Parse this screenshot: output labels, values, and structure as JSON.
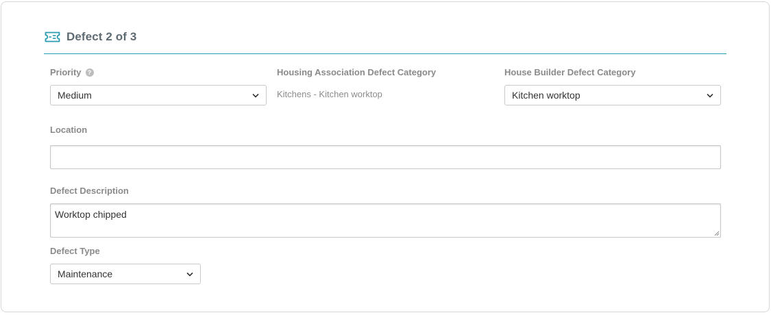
{
  "header": {
    "title": "Defect 2 of 3",
    "icon": "ticket-icon",
    "accent_color": "#2a9bb0"
  },
  "priority": {
    "label": "Priority",
    "help_icon": "?",
    "selected": "Medium"
  },
  "ha_category": {
    "label": "Housing Association Defect Category",
    "value": "Kitchens - Kitchen worktop"
  },
  "hb_category": {
    "label": "House Builder Defect Category",
    "selected": "Kitchen worktop"
  },
  "location": {
    "label": "Location",
    "value": ""
  },
  "description": {
    "label": "Defect Description",
    "value": "Worktop chipped"
  },
  "defect_type": {
    "label": "Defect Type",
    "selected": "Maintenance"
  }
}
